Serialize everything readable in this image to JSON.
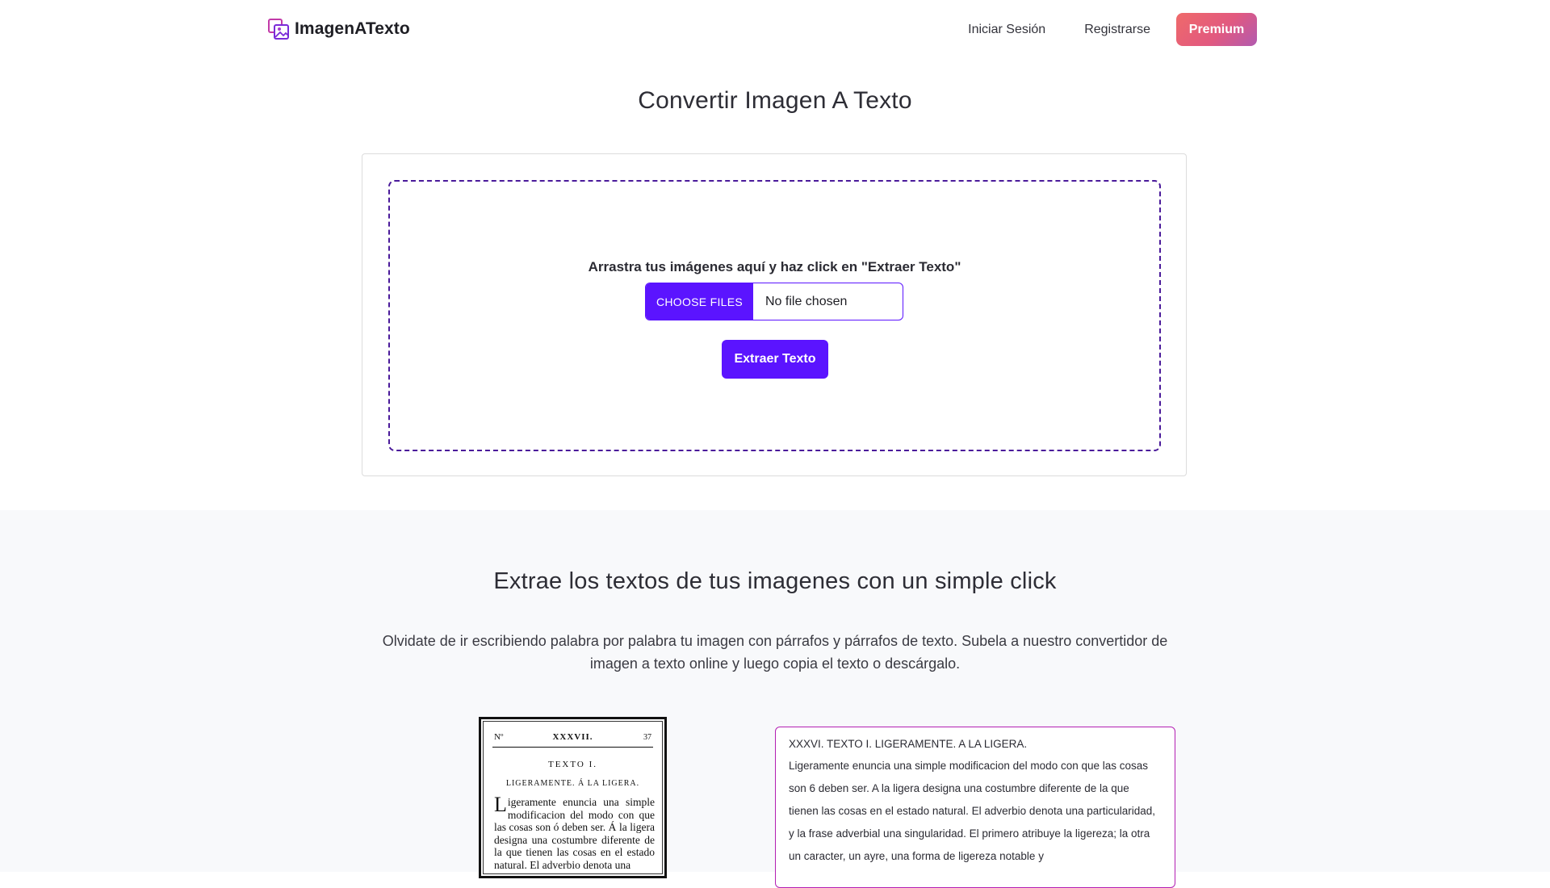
{
  "header": {
    "logo_text": "ImagenATexto",
    "logo_icon": "image-scan-icon",
    "nav": {
      "login": "Iniciar Sesión",
      "register": "Registrarse",
      "premium": "Premium"
    }
  },
  "main": {
    "title": "Convertir Imagen A Texto",
    "upload": {
      "drop_text": "Arrastra tus imágenes aquí y haz click en \"Extraer Texto\"",
      "choose_files": "CHOOSE FILES",
      "file_status": "No file chosen",
      "extract_button": "Extraer Texto"
    }
  },
  "info": {
    "title": "Extrae los textos de tus imagenes con un simple click",
    "description": "Olvidate de ir escribiendo palabra por palabra tu imagen con párrafos y párrafos de texto. Subela a nuestro convertidor de imagen a texto online y luego copia el texto o descárgalo."
  },
  "example": {
    "book": {
      "number_prefix": "Nº",
      "number": "XXXVII.",
      "page": "37",
      "heading": "TEXTO I.",
      "subheading": "LIGERAMENTE. Á LA LIGERA.",
      "dropcap": "L",
      "body": "igeramente enuncia una simple modificacion del modo con que las cosas son ó deben ser. Á la ligera designa una costumbre diferente de la que tienen las cosas en el estado natural. El adverbio denota una"
    },
    "result": {
      "title": "XXXVI. TEXTO I. LIGERAMENTE. A LA LIGERA.",
      "body": "Ligeramente enuncia una simple modificacion del modo con que las cosas son 6 deben ser. A la ligera designa una costumbre diferente de la que tienen las cosas en el estado natural. El adverbio denota una particularidad, y la frase adverbial una singularidad. El primero atribuye la ligereza; la otra un caracter, un ayre, una forma de ligereza notable y"
    }
  },
  "colors": {
    "primary": "#5b14ff",
    "dropzone_border": "#4a1a9a",
    "result_border": "#b31fb3",
    "premium_gradient_start": "#ef6a6a",
    "premium_gradient_end": "#b15ab0",
    "section_bg": "#f8f9fb"
  }
}
